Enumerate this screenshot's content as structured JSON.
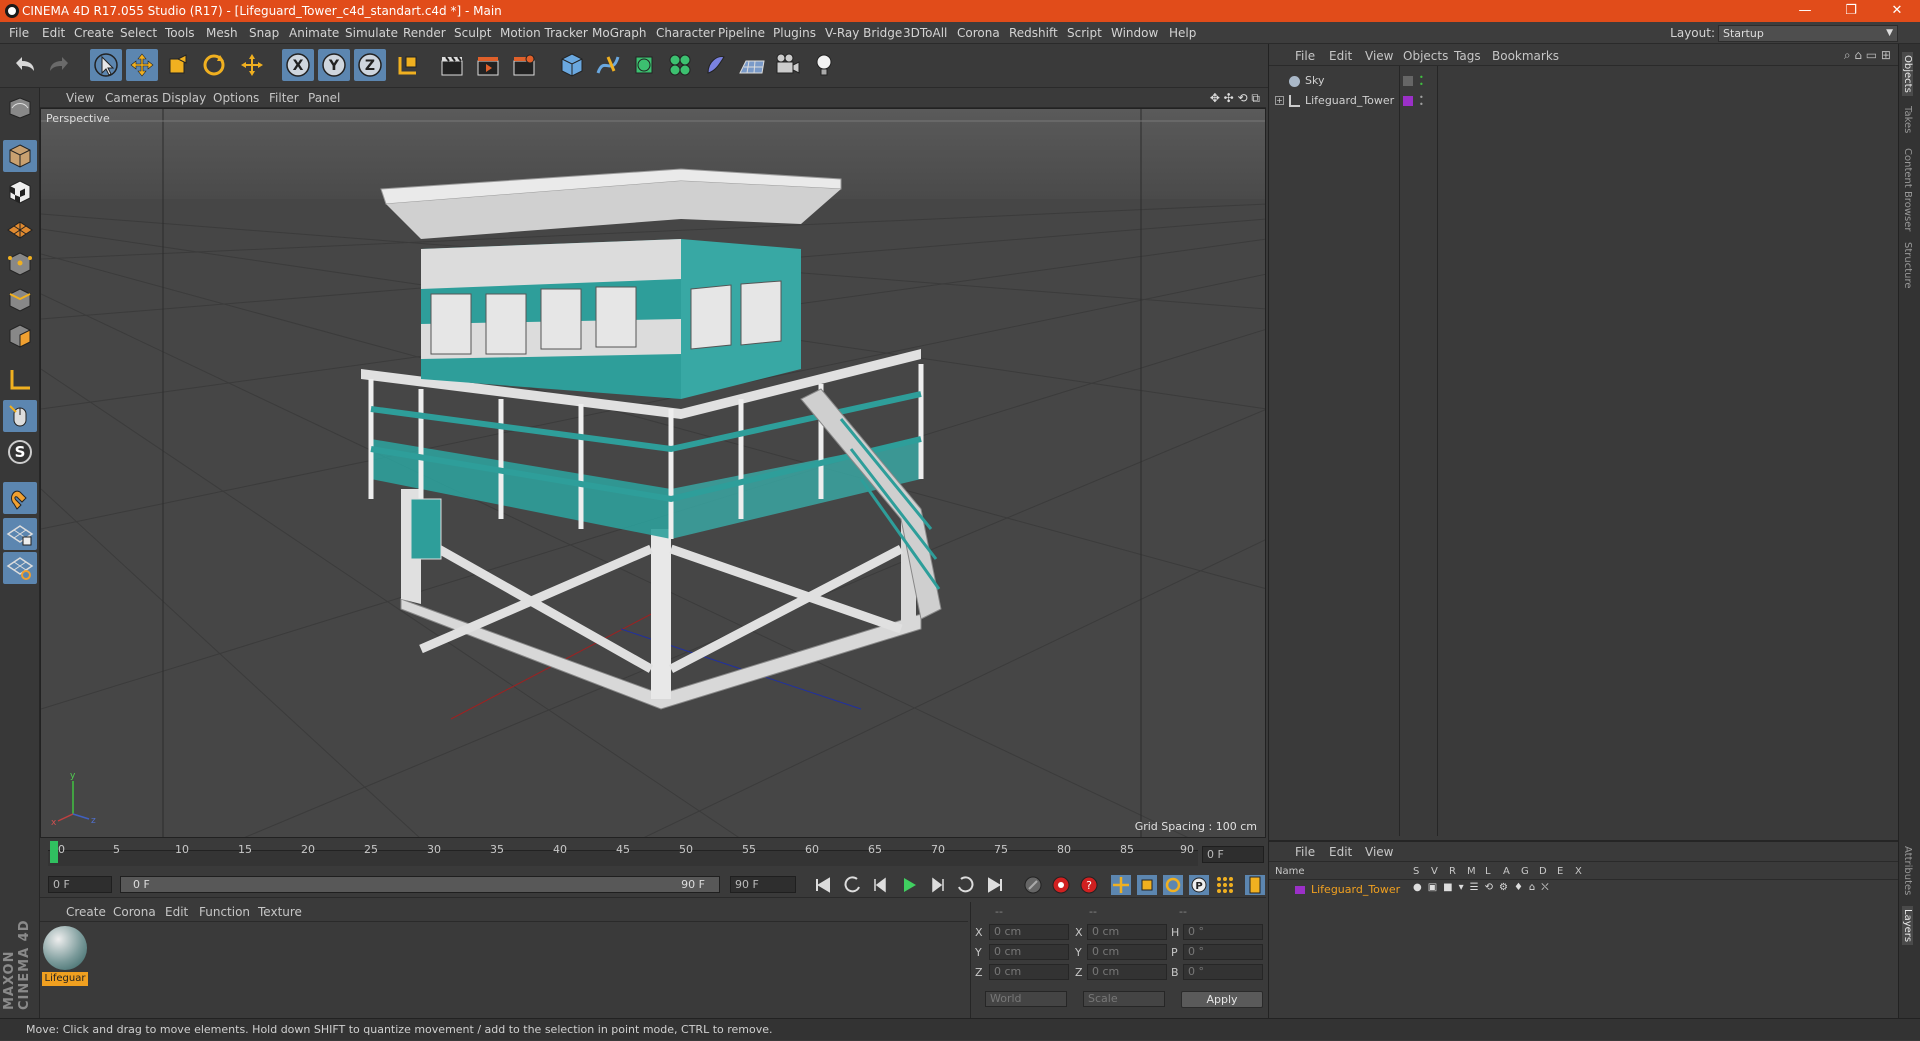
{
  "window": {
    "title": "CINEMA 4D R17.055 Studio (R17) - [Lifeguard_Tower_c4d_standart.c4d *] - Main",
    "minimize": "—",
    "restore": "❐",
    "close": "✕"
  },
  "menu": [
    "File",
    "Edit",
    "Create",
    "Select",
    "Tools",
    "Mesh",
    "Snap",
    "Animate",
    "Simulate",
    "Render",
    "Sculpt",
    "Motion Tracker",
    "MoGraph",
    "Character",
    "Pipeline",
    "Plugins",
    "V-Ray Bridge",
    "3DToAll",
    "Corona",
    "Redshift",
    "Script",
    "Window",
    "Help"
  ],
  "layout": {
    "label": "Layout:",
    "value": "Startup"
  },
  "viewport": {
    "menu": [
      "View",
      "Cameras",
      "Display",
      "Options",
      "Filter",
      "Panel"
    ],
    "label": "Perspective",
    "grid_spacing": "Grid Spacing : 100 cm"
  },
  "timeline": {
    "ticks": [
      "0",
      "5",
      "10",
      "15",
      "20",
      "25",
      "30",
      "35",
      "40",
      "45",
      "50",
      "55",
      "60",
      "65",
      "70",
      "75",
      "80",
      "85",
      "90"
    ],
    "current_frame": "0 F",
    "start_field": "0 F",
    "range_start": "0 F",
    "range_end": "90 F",
    "end_field": "90 F"
  },
  "material": {
    "menu": [
      "Create",
      "Corona",
      "Edit",
      "Function",
      "Texture"
    ],
    "items": [
      {
        "name": "Lifeguar"
      }
    ]
  },
  "coords": {
    "headers": [
      "--",
      "--",
      "--"
    ],
    "rows": [
      {
        "a": "X",
        "av": "0 cm",
        "b": "X",
        "bv": "0 cm",
        "c": "H",
        "cv": "0 °"
      },
      {
        "a": "Y",
        "av": "0 cm",
        "b": "Y",
        "bv": "0 cm",
        "c": "P",
        "cv": "0 °"
      },
      {
        "a": "Z",
        "av": "0 cm",
        "b": "Z",
        "bv": "0 cm",
        "c": "B",
        "cv": "0 °"
      }
    ],
    "world": "World",
    "scale": "Scale",
    "apply": "Apply"
  },
  "objects": {
    "menu": [
      "File",
      "Edit",
      "View",
      "Objects",
      "Tags",
      "Bookmarks"
    ],
    "items": [
      {
        "name": "Sky",
        "color": "#555555"
      },
      {
        "name": "Lifeguard_Tower",
        "color": "#9b30c8"
      }
    ]
  },
  "layers": {
    "menu": [
      "File",
      "Edit",
      "View"
    ],
    "columns": [
      "Name",
      "S",
      "V",
      "R",
      "M",
      "L",
      "A",
      "G",
      "D",
      "E",
      "X"
    ],
    "items": [
      {
        "name": "Lifeguard_Tower",
        "color": "#9b30c8"
      }
    ]
  },
  "side_tabs": [
    "Objects",
    "Takes",
    "Content Browser",
    "Structure"
  ],
  "side_tabs_bottom": [
    "Attributes",
    "Layers"
  ],
  "maxon": "MAXON CINEMA 4D",
  "status": "Move: Click and drag to move elements. Hold down SHIFT to quantize movement / add to the selection in point mode, CTRL to remove.",
  "colors": {
    "title_bar": "#e14c1a",
    "active_tool": "#5c86b0",
    "tower_teal": "#2e9e9a",
    "selection_orange": "#f0a020"
  }
}
